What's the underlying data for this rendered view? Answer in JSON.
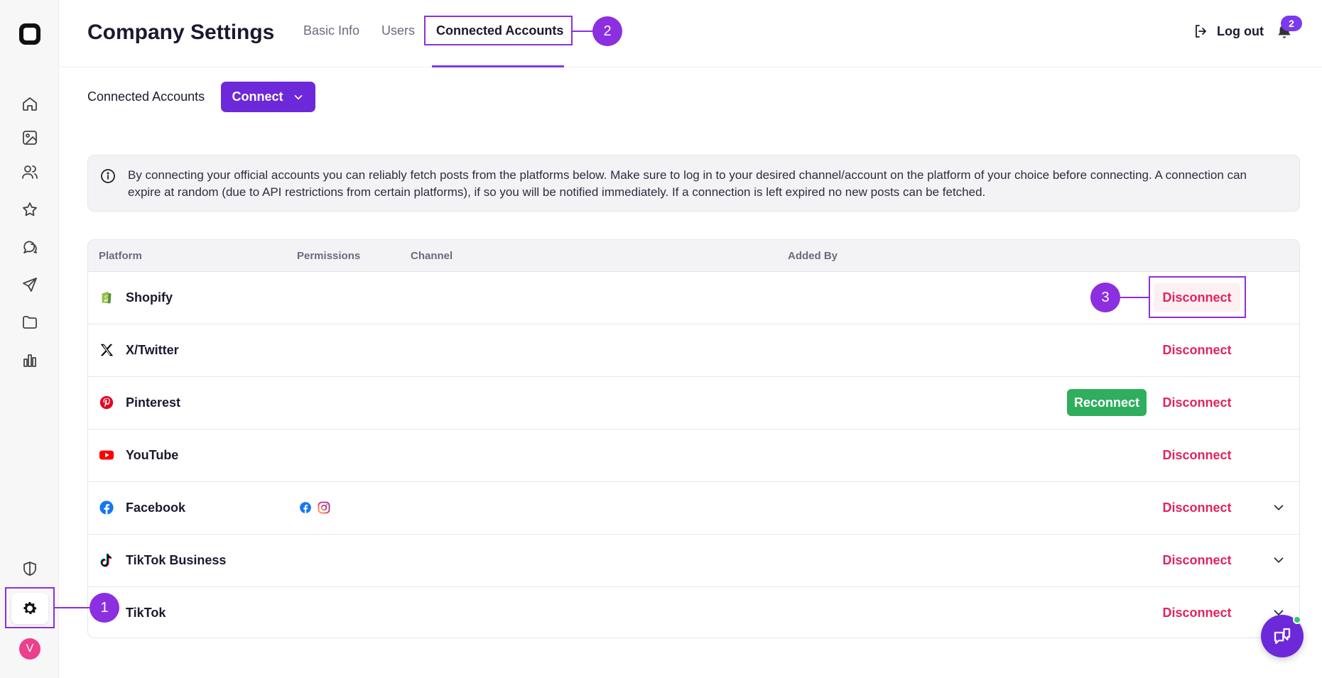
{
  "header": {
    "title": "Company Settings",
    "tabs": [
      {
        "label": "Basic Info"
      },
      {
        "label": "Users"
      },
      {
        "label": "Connected Accounts"
      }
    ],
    "logout_label": "Log out",
    "notification_count": "2"
  },
  "toolbar": {
    "label": "Connected Accounts",
    "connect_label": "Connect"
  },
  "info": {
    "text": "By connecting your official accounts you can reliably fetch posts from the platforms below. Make sure to log in to your desired channel/account on the platform of your choice before connecting. A connection can expire at random (due to API restrictions from certain platforms), if so you will be notified immediately. If a connection is left expired no new posts can be fetched."
  },
  "table": {
    "columns": [
      "Platform",
      "Permissions",
      "Channel",
      "Added By"
    ],
    "rows": [
      {
        "platform": "Shopify",
        "icon": "shopify-icon",
        "disconnect": "Disconnect"
      },
      {
        "platform": "X/Twitter",
        "icon": "x-icon",
        "disconnect": "Disconnect"
      },
      {
        "platform": "Pinterest",
        "icon": "pinterest-icon",
        "reconnect": "Reconnect",
        "disconnect": "Disconnect"
      },
      {
        "platform": "YouTube",
        "icon": "youtube-icon",
        "disconnect": "Disconnect"
      },
      {
        "platform": "Facebook",
        "icon": "facebook-icon",
        "permissions": [
          "facebook-icon",
          "instagram-icon"
        ],
        "disconnect": "Disconnect",
        "expandable": true
      },
      {
        "platform": "TikTok Business",
        "icon": "tiktok-icon",
        "disconnect": "Disconnect",
        "expandable": true
      },
      {
        "platform": "TikTok",
        "icon": "tiktok-icon",
        "disconnect": "Disconnect",
        "expandable": true
      }
    ]
  },
  "annotations": [
    "1",
    "2",
    "3"
  ],
  "avatar_initial": "V",
  "colors": {
    "accent": "#6d28d9",
    "annotation": "#8b2fe0",
    "danger": "#e0245e",
    "success": "#2fae5e"
  }
}
